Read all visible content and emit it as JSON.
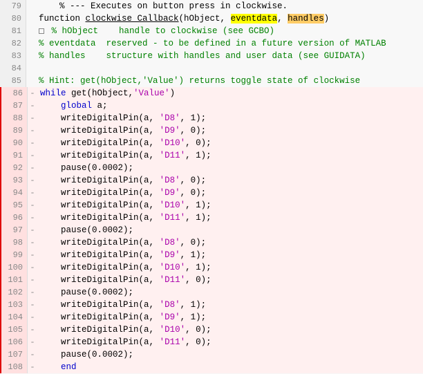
{
  "editor": {
    "lines": [
      {
        "num": 79,
        "dash": "",
        "selected": false,
        "content": [
          {
            "t": "    % --- Executes on button press in clockwise.",
            "cls": "kw-comment"
          }
        ]
      },
      {
        "num": 80,
        "dash": "",
        "selected": false,
        "content": [
          {
            "t": "function ",
            "cls": "kw-black"
          },
          {
            "t": "clockwise_Callback",
            "cls": "kw-black kw-underline"
          },
          {
            "t": "(hObject, ",
            "cls": "kw-black"
          },
          {
            "t": "eventdata",
            "cls": "kw-highlight-yellow"
          },
          {
            "t": ", ",
            "cls": "kw-black"
          },
          {
            "t": "handles",
            "cls": "kw-highlight-orange"
          },
          {
            "t": ")",
            "cls": "kw-black"
          }
        ]
      },
      {
        "num": 81,
        "dash": "",
        "selected": false,
        "content": [
          {
            "t": "% hObject    handle to clockwise (see GCBO)",
            "cls": "kw-comment"
          }
        ]
      },
      {
        "num": 82,
        "dash": "",
        "selected": false,
        "content": [
          {
            "t": "% eventdata  reserved - to be defined in a future version of MATLAB",
            "cls": "kw-comment"
          }
        ]
      },
      {
        "num": 83,
        "dash": "",
        "selected": false,
        "content": [
          {
            "t": "% handles    structure with handles and user data (see GUIDATA)",
            "cls": "kw-comment"
          }
        ]
      },
      {
        "num": 84,
        "dash": "",
        "selected": false,
        "content": []
      },
      {
        "num": 85,
        "dash": "",
        "selected": false,
        "content": [
          {
            "t": "% Hint: get(hObject,'Value') returns toggle state of clockwise",
            "cls": "kw-comment"
          }
        ]
      },
      {
        "num": 86,
        "dash": "-",
        "selected": true,
        "content": [
          {
            "t": "while get(hObject,'Value')",
            "cls": "kw-black",
            "parts": [
              {
                "t": "while",
                "cls": "kw-blue"
              },
              {
                "t": " get(hObject,",
                "cls": "kw-black"
              },
              {
                "t": "'Value'",
                "cls": "kw-string"
              },
              {
                "t": ")",
                "cls": "kw-black"
              }
            ]
          }
        ]
      },
      {
        "num": 87,
        "dash": "-",
        "selected": true,
        "content": [
          {
            "t": "    global a;",
            "cls": "kw-blue-global"
          }
        ]
      },
      {
        "num": 88,
        "dash": "-",
        "selected": true,
        "content": [
          {
            "t": "    writeDigitalPin(a, 'D8', 1);",
            "cls": ""
          }
        ]
      },
      {
        "num": 89,
        "dash": "-",
        "selected": true,
        "content": [
          {
            "t": "    writeDigitalPin(a, 'D9', 0);",
            "cls": ""
          }
        ]
      },
      {
        "num": 90,
        "dash": "-",
        "selected": true,
        "content": [
          {
            "t": "    writeDigitalPin(a, 'D10', 0);",
            "cls": ""
          }
        ]
      },
      {
        "num": 91,
        "dash": "-",
        "selected": true,
        "content": [
          {
            "t": "    writeDigitalPin(a, 'D11', 1);",
            "cls": ""
          }
        ]
      },
      {
        "num": 92,
        "dash": "-",
        "selected": true,
        "content": [
          {
            "t": "    pause(0.0002);",
            "cls": ""
          }
        ]
      },
      {
        "num": 93,
        "dash": "-",
        "selected": true,
        "content": [
          {
            "t": "    writeDigitalPin(a, 'D8', 0);",
            "cls": ""
          }
        ]
      },
      {
        "num": 94,
        "dash": "-",
        "selected": true,
        "content": [
          {
            "t": "    writeDigitalPin(a, 'D9', 0);",
            "cls": ""
          }
        ]
      },
      {
        "num": 95,
        "dash": "-",
        "selected": true,
        "content": [
          {
            "t": "    writeDigitalPin(a, 'D10', 1);",
            "cls": ""
          }
        ]
      },
      {
        "num": 96,
        "dash": "-",
        "selected": true,
        "content": [
          {
            "t": "    writeDigitalPin(a, 'D11', 1);",
            "cls": ""
          }
        ]
      },
      {
        "num": 97,
        "dash": "-",
        "selected": true,
        "content": [
          {
            "t": "    pause(0.0002);",
            "cls": ""
          }
        ]
      },
      {
        "num": 98,
        "dash": "-",
        "selected": true,
        "content": [
          {
            "t": "    writeDigitalPin(a, 'D8', 0);",
            "cls": ""
          }
        ]
      },
      {
        "num": 99,
        "dash": "-",
        "selected": true,
        "content": [
          {
            "t": "    writeDigitalPin(a, 'D9', 1);",
            "cls": ""
          }
        ]
      },
      {
        "num": 100,
        "dash": "-",
        "selected": true,
        "content": [
          {
            "t": "    writeDigitalPin(a, 'D10', 1);",
            "cls": ""
          }
        ]
      },
      {
        "num": 101,
        "dash": "-",
        "selected": true,
        "content": [
          {
            "t": "    writeDigitalPin(a, 'D11', 0);",
            "cls": ""
          }
        ]
      },
      {
        "num": 102,
        "dash": "-",
        "selected": true,
        "content": [
          {
            "t": "    pause(0.0002);",
            "cls": ""
          }
        ]
      },
      {
        "num": 103,
        "dash": "-",
        "selected": true,
        "content": [
          {
            "t": "    writeDigitalPin(a, 'D8', 1);",
            "cls": ""
          }
        ]
      },
      {
        "num": 104,
        "dash": "-",
        "selected": true,
        "content": [
          {
            "t": "    writeDigitalPin(a, 'D9', 1);",
            "cls": ""
          }
        ]
      },
      {
        "num": 105,
        "dash": "-",
        "selected": true,
        "content": [
          {
            "t": "    writeDigitalPin(a, 'D10', 0);",
            "cls": ""
          }
        ]
      },
      {
        "num": 106,
        "dash": "-",
        "selected": true,
        "content": [
          {
            "t": "    writeDigitalPin(a, 'D11', 0);",
            "cls": ""
          }
        ]
      },
      {
        "num": 107,
        "dash": "-",
        "selected": true,
        "content": [
          {
            "t": "    pause(0.0002);",
            "cls": ""
          }
        ]
      },
      {
        "num": 108,
        "dash": "-",
        "selected": true,
        "content": [
          {
            "t": "end",
            "cls": "kw-blue-end"
          }
        ]
      }
    ]
  }
}
